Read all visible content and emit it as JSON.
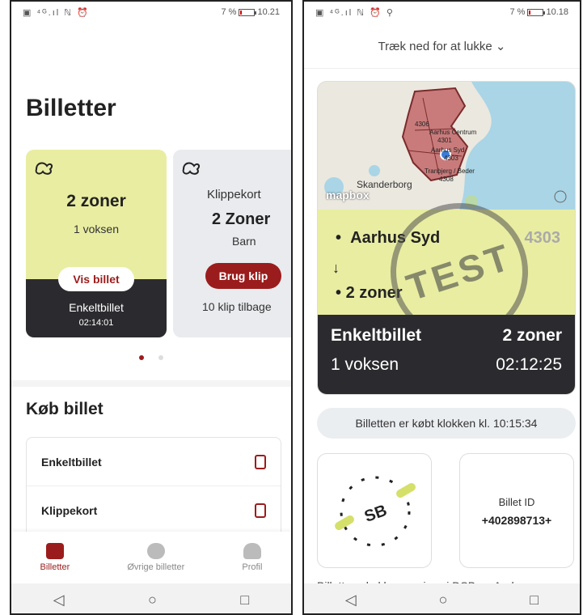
{
  "left": {
    "status": {
      "icons": "▣ ⁴ᴳ.ıl ℕ ⏰",
      "battery": "7 %",
      "time": "10.21"
    },
    "title": "Billetter",
    "card1": {
      "zones": "2 zoner",
      "passengers": "1 voksen",
      "button": "Vis billet",
      "type": "Enkeltbillet",
      "timer": "02:14:01"
    },
    "card2": {
      "title": "Klippekort",
      "zones": "2 Zoner",
      "passengers": "Barn",
      "button": "Brug klip",
      "remaining": "10 klip tilbage"
    },
    "buy": {
      "title": "Køb billet",
      "items": [
        "Enkeltbillet",
        "Klippekort"
      ]
    },
    "nav": {
      "tickets": "Billetter",
      "other": "Øvrige billetter",
      "profile": "Profil"
    }
  },
  "right": {
    "status": {
      "icons": "▣ ⁴ᴳ.ıl ℕ ⏰ ⚲",
      "battery": "7 %",
      "time": "10.18"
    },
    "pull": "Træk ned for at lukke",
    "map": {
      "labels": [
        "4306",
        "Aarhus Centrum",
        "4301",
        "Aarhus Syd",
        "4303",
        "Tranbjerg / Beder",
        "4308",
        "Skanderborg"
      ],
      "brand": "mapbox"
    },
    "from": "Aarhus Syd",
    "from_code": "4303",
    "to": "2 zoner",
    "stamp": "TEST",
    "ticket": {
      "type": "Enkeltbillet",
      "zones": "2 zoner",
      "passengers": "1 voksen",
      "timer": "02:12:25"
    },
    "bought": "Billetten er købt klokken kl. 10:15:34",
    "sb": "SB",
    "billet_id_label": "Billet ID",
    "billet_id": "+402898713+",
    "cut_text": "Billetten skal kunne vises i DSB og Aarhus..."
  }
}
